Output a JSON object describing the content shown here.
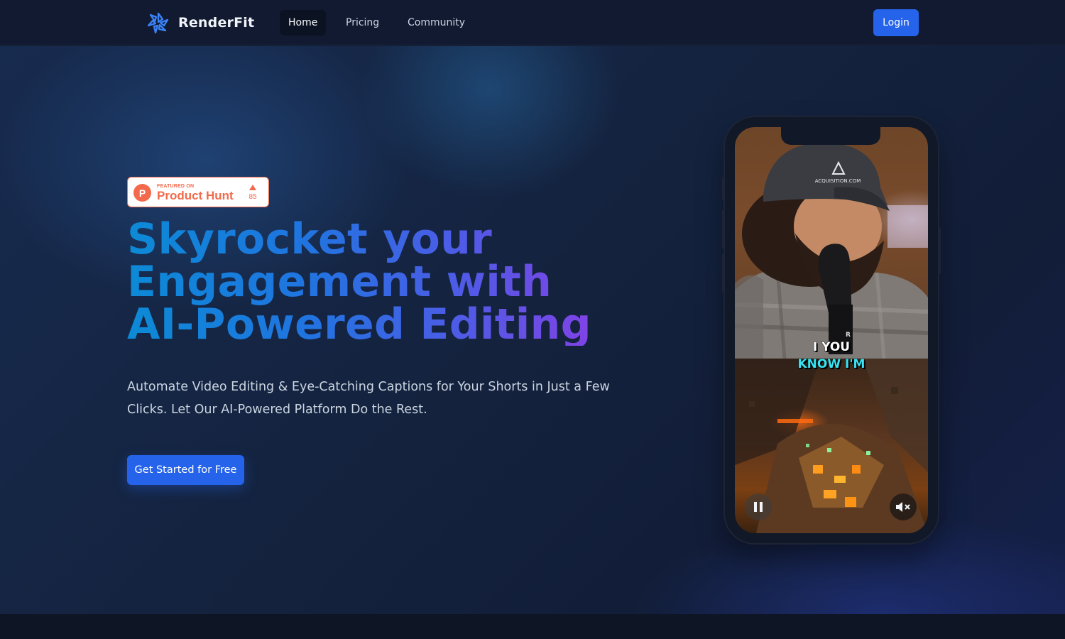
{
  "nav": {
    "brand": "RenderFit",
    "links": [
      {
        "label": "Home",
        "active": true
      },
      {
        "label": "Pricing",
        "active": false
      },
      {
        "label": "Community",
        "active": false
      }
    ],
    "login_label": "Login"
  },
  "badge": {
    "small_text": "FEATURED ON",
    "name": "Product Hunt",
    "upvotes": "85"
  },
  "hero": {
    "headline_lines": [
      "Skyrocket your",
      "Engagement with",
      "AI-Powered Editing"
    ],
    "subtext": "Automate Video Editing & Eye-Catching Captions for Your Shorts in Just a Few Clicks. Let Our AI-Powered Platform Do the Rest.",
    "cta_label": "Get Started for Free"
  },
  "video": {
    "caption_line1": "I YOU",
    "caption_line2": "KNOW I'M",
    "cap_text": "ACQUISITION.COM",
    "mic_letter": "R",
    "controls": {
      "pause_icon": "pause-icon",
      "mute_icon": "mute-icon"
    }
  },
  "colors": {
    "accent": "#2563eb",
    "product_hunt": "#f26a4b",
    "caption_cyan": "#38e3f2"
  }
}
